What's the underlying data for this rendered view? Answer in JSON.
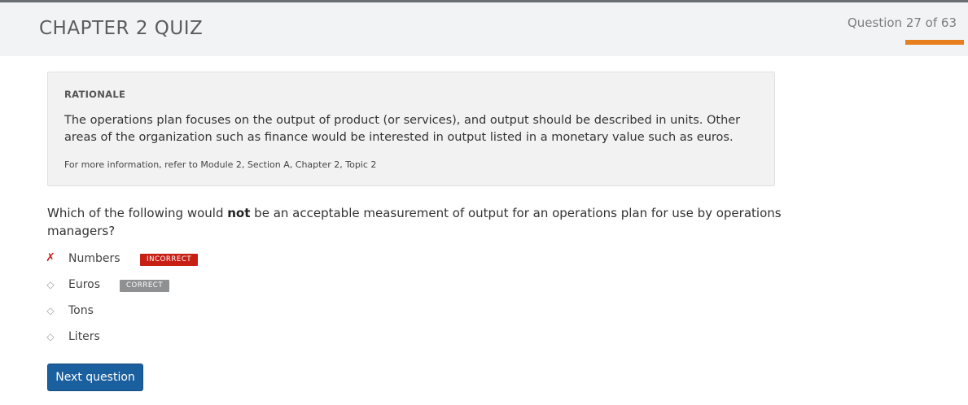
{
  "header": {
    "title": "CHAPTER 2 QUIZ",
    "question_counter": "Question 27 of 63",
    "progress_fraction": 0.43,
    "progress_color": "#e87f1e"
  },
  "rationale": {
    "heading": "RATIONALE",
    "text": "The operations plan focuses on the output of product (or services), and output should be described in units. Other areas of the organization such as finance would be interested in output listed in a monetary value such as euros.",
    "reference": "For more information, refer to Module 2, Section A, Chapter 2, Topic 2"
  },
  "question": {
    "before": "Which of the following would ",
    "emphasis": "not",
    "after": " be an acceptable measurement of output for an operations plan for use by operations managers?"
  },
  "answers": [
    {
      "label": "Numbers",
      "mark": "✗",
      "status": "wrong",
      "badge": "INCORRECT"
    },
    {
      "label": "Euros",
      "mark": "◇",
      "status": "correct",
      "badge": "CORRECT"
    },
    {
      "label": "Tons",
      "mark": "◇",
      "status": "none",
      "badge": ""
    },
    {
      "label": "Liters",
      "mark": "◇",
      "status": "none",
      "badge": ""
    }
  ],
  "buttons": {
    "next": "Next question"
  },
  "colors": {
    "incorrect_badge": "#c81f15",
    "correct_badge": "#8e9092",
    "primary_button": "#1a5f9e"
  }
}
